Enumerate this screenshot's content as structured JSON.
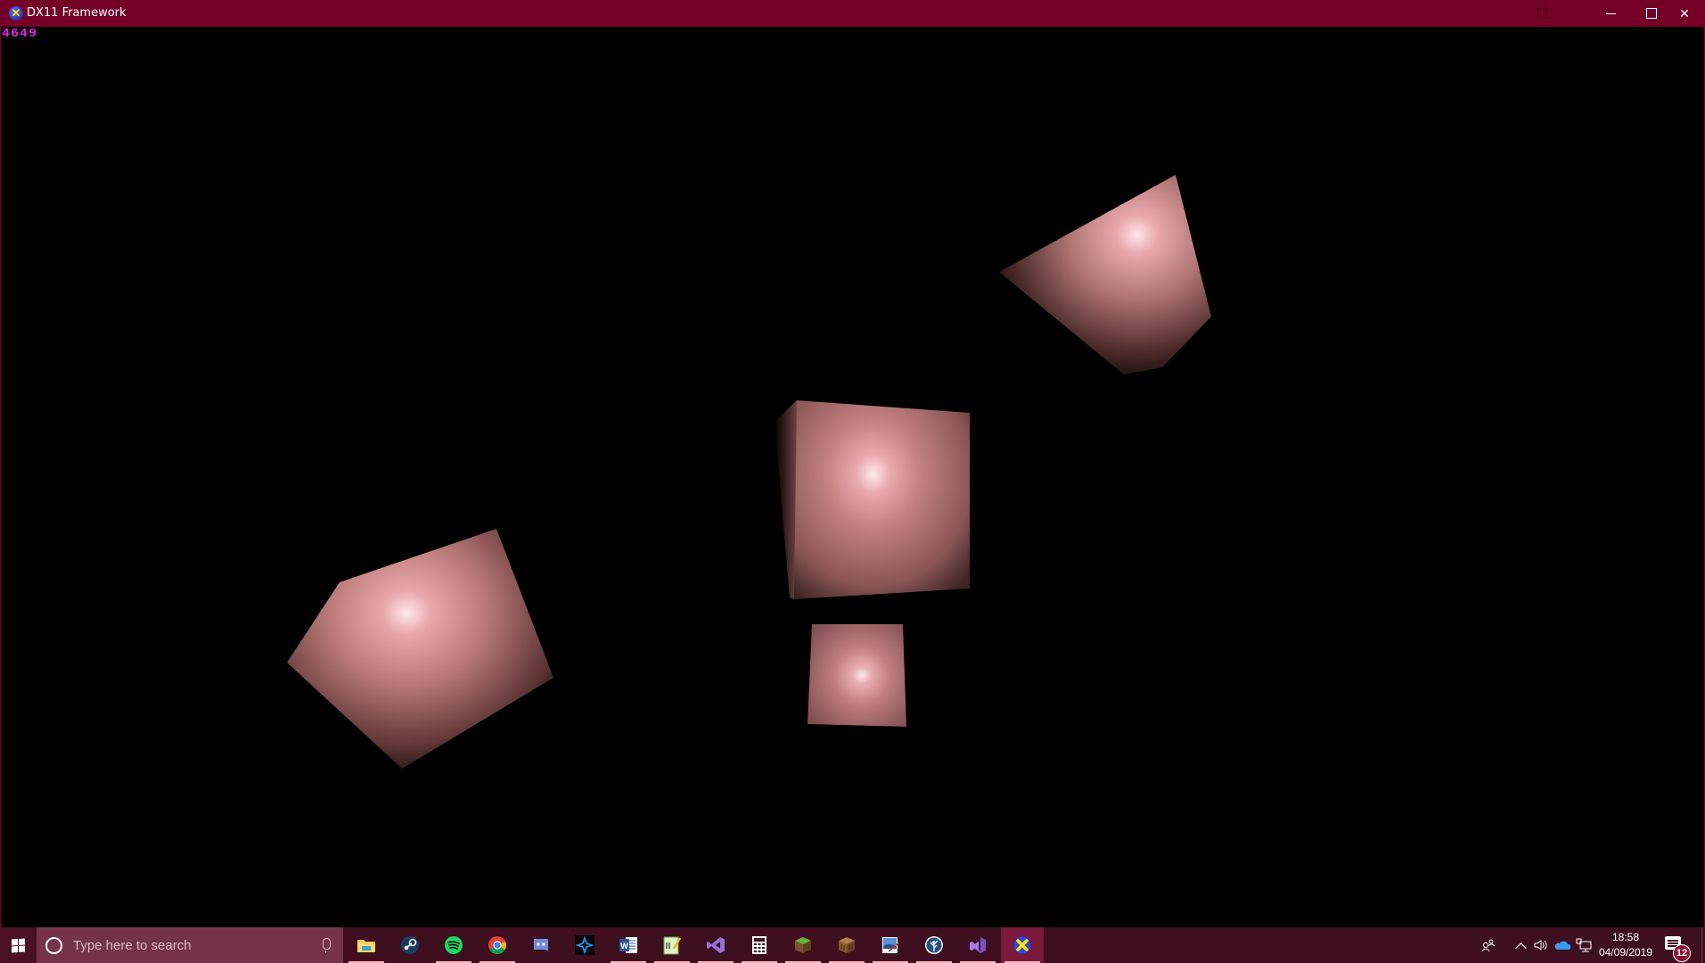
{
  "window": {
    "title": "DX11 Framework",
    "icon": "directx-icon",
    "controls": {
      "minimize": "minimize-icon",
      "maximize": "maximize-icon",
      "close": "close-icon"
    },
    "colors": {
      "titlebar": "#750027",
      "text": "#ffffff"
    }
  },
  "viewport": {
    "fps_counter": "4649",
    "fps_color": "#e21fe6",
    "background": "#000000",
    "objects": [
      {
        "name": "cube-center",
        "color": "#c98585",
        "highlight": "#ffe6e8"
      },
      {
        "name": "cube-small",
        "color": "#c98585",
        "highlight": "#ffe6e8"
      },
      {
        "name": "cube-left",
        "color": "#c98585",
        "highlight": "#ffe6e8"
      },
      {
        "name": "cube-top-right",
        "color": "#c98585",
        "highlight": "#ffe6e8"
      }
    ]
  },
  "taskbar": {
    "background": "#3d0f1f",
    "search": {
      "placeholder": "Type here to search"
    },
    "apps": [
      {
        "name": "file-explorer",
        "icon": "folder-icon",
        "running": true
      },
      {
        "name": "steam",
        "icon": "steam-icon",
        "running": false
      },
      {
        "name": "spotify",
        "icon": "spotify-icon",
        "running": true
      },
      {
        "name": "chrome",
        "icon": "chrome-icon",
        "running": true
      },
      {
        "name": "discord",
        "icon": "discord-icon",
        "running": false
      },
      {
        "name": "battle-net",
        "icon": "battlenet-icon",
        "running": false
      },
      {
        "name": "word",
        "icon": "word-icon",
        "running": true
      },
      {
        "name": "notepad-plus-plus",
        "icon": "notepad-icon",
        "running": true
      },
      {
        "name": "visual-studio",
        "icon": "visual-studio-icon",
        "running": true
      },
      {
        "name": "calculator",
        "icon": "calculator-icon",
        "running": true
      },
      {
        "name": "minecraft",
        "icon": "minecraft-icon",
        "running": true
      },
      {
        "name": "crafting-table",
        "icon": "crafting-table-icon",
        "running": true
      },
      {
        "name": "paint",
        "icon": "paint-icon",
        "running": true
      },
      {
        "name": "sourcetree",
        "icon": "sourcetree-icon",
        "running": true
      },
      {
        "name": "visual-studio-2",
        "icon": "visual-studio-icon",
        "running": true
      },
      {
        "name": "dx11-framework",
        "icon": "directx-icon",
        "running": true,
        "active": true
      }
    ],
    "tray": {
      "clock_time": "18:58",
      "clock_date": "04/09/2019",
      "notification_count": "12"
    }
  }
}
